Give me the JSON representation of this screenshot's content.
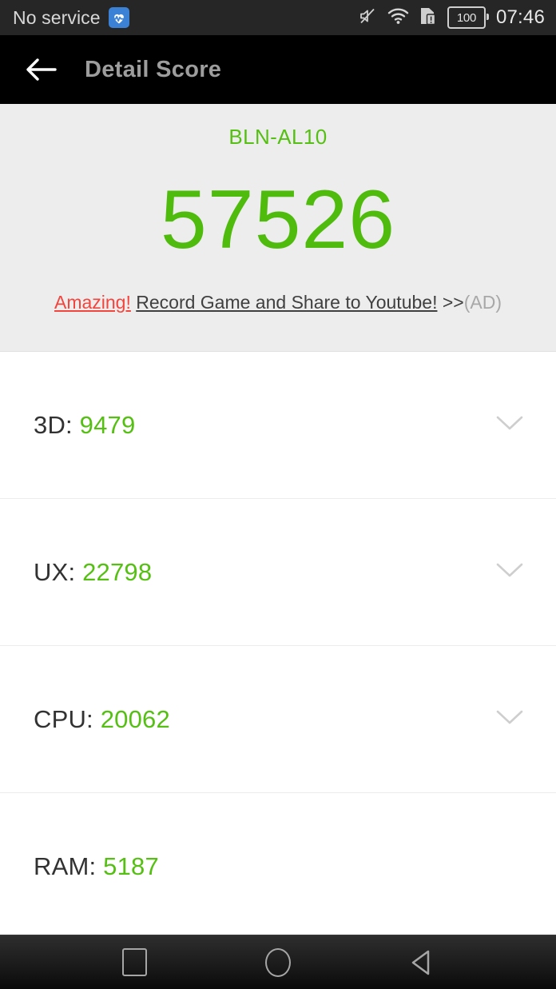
{
  "status_bar": {
    "carrier": "No service",
    "health_icon": "heart-pulse-icon",
    "mute_icon": "volume-mute-icon",
    "wifi_icon": "wifi-icon",
    "sim_icon": "sim-card-alert-icon",
    "battery_level": "100",
    "time": "07:46"
  },
  "app_bar": {
    "back_icon": "arrow-back-icon",
    "title": "Detail Score"
  },
  "summary": {
    "device_model": "BLN-AL10",
    "total_score": "57526",
    "ad": {
      "strong": "Amazing!",
      "body": "Record Game and Share to Youtube!",
      "arrows": ">>",
      "tag": "(AD)"
    }
  },
  "scores": [
    {
      "label": "3D:",
      "value": "9479",
      "expandable": true
    },
    {
      "label": "UX:",
      "value": "22798",
      "expandable": true
    },
    {
      "label": "CPU:",
      "value": "20062",
      "expandable": true
    },
    {
      "label": "RAM:",
      "value": "5187",
      "expandable": false
    }
  ],
  "nav_bar": {
    "recents_icon": "recents-square-icon",
    "home_icon": "home-circle-icon",
    "back_icon": "back-triangle-icon"
  },
  "colors": {
    "accent_green": "#55c013",
    "ad_red": "#f2453d",
    "summary_bg": "#ededed",
    "app_bar_bg": "#000000"
  }
}
